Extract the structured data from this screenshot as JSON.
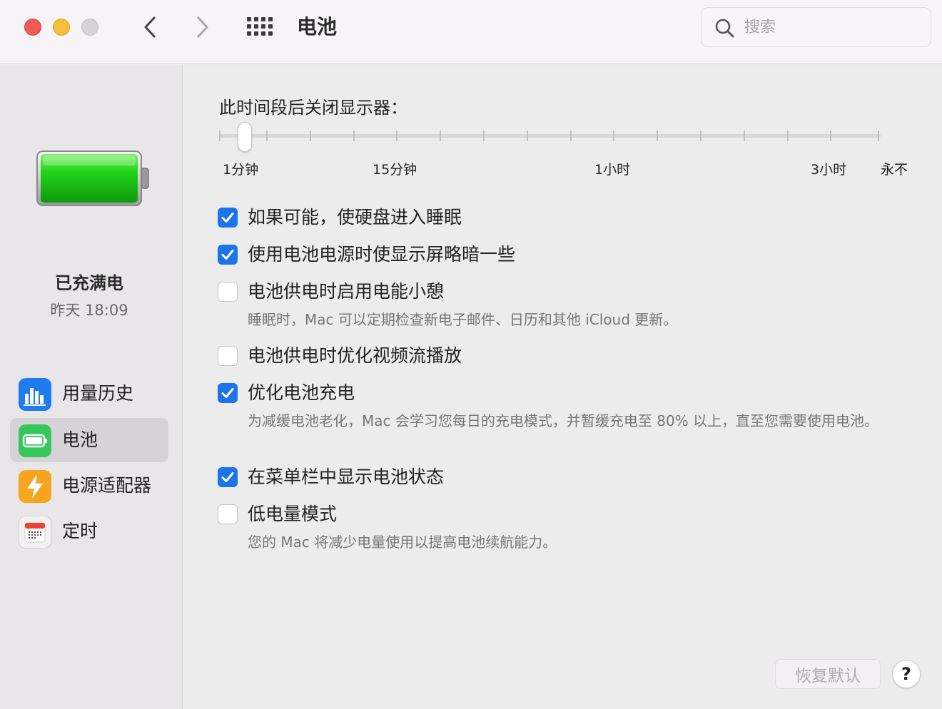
{
  "window": {
    "title": "电池"
  },
  "search": {
    "placeholder": "搜索"
  },
  "sidebar": {
    "status_title": "已充满电",
    "status_time": "昨天 18:09",
    "items": [
      {
        "label": "用量历史",
        "icon": "bar-chart-icon",
        "color": "#1f7cf0"
      },
      {
        "label": "电池",
        "icon": "battery-icon",
        "color": "#34c759",
        "active": true
      },
      {
        "label": "电源适配器",
        "icon": "lightning-bolt-icon",
        "color": "#f7a51f"
      },
      {
        "label": "定时",
        "icon": "calendar-icon",
        "color": "#ef4136"
      }
    ]
  },
  "display_off": {
    "label": "此时间段后关闭显示器：",
    "tick_labels": [
      "1分钟",
      "15分钟",
      "1小时",
      "3小时",
      "永不"
    ]
  },
  "options": [
    {
      "label": "如果可能，使硬盘进入睡眠",
      "checked": true
    },
    {
      "label": "使用电池电源时使显示屏略暗一些",
      "checked": true
    },
    {
      "label": "电池供电时启用电能小憩",
      "checked": false,
      "description": "睡眠时，Mac 可以定期检查新电子邮件、日历和其他 iCloud 更新。"
    },
    {
      "label": "电池供电时优化视频流播放",
      "checked": false
    },
    {
      "label": "优化电池充电",
      "checked": true,
      "description": "为减缓电池老化，Mac 会学习您每日的充电模式，并暂缓充电至 80% 以上，直至您需要使用电池。"
    },
    {
      "label": "在菜单栏中显示电池状态",
      "checked": true
    },
    {
      "label": "低电量模式",
      "checked": false,
      "description": "您的 Mac 将减少电量使用以提高电池续航能力。"
    }
  ],
  "buttons": {
    "restore": "恢复默认",
    "help": "?"
  },
  "colors": {
    "accent": "#1b74e8",
    "battery_green": "#34c759"
  }
}
